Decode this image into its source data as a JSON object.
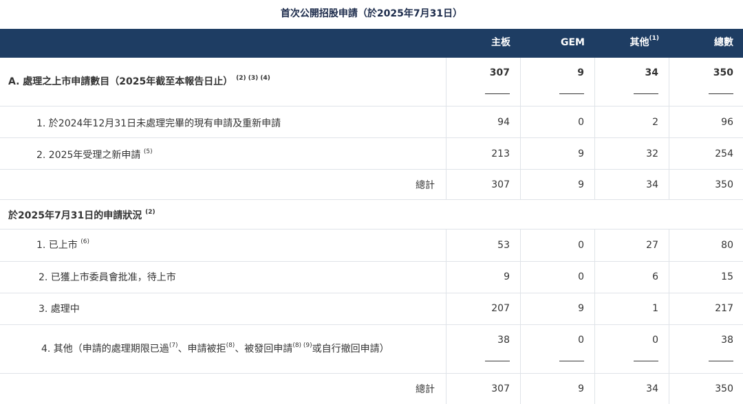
{
  "title": "首次公開招股申請（於2025年7月31日）",
  "header": {
    "col_main": "主板",
    "col_gem": "GEM",
    "col_other": "其他",
    "col_other_note": "(1)",
    "col_total": "總數"
  },
  "section_a": {
    "label": "A. 處理之上市申請數目（2025年截至本報告日止）",
    "notes": "(2) (3) (4)",
    "values": [
      "307",
      "9",
      "34",
      "350"
    ]
  },
  "section_a_rows": [
    {
      "label": "1. 於2024年12月31日未處理完畢的現有申請及重新申請",
      "notes": "",
      "values": [
        "94",
        "0",
        "2",
        "96"
      ]
    },
    {
      "label": "2. 2025年受理之新申請",
      "notes": "(5)",
      "values": [
        "213",
        "9",
        "32",
        "254"
      ]
    }
  ],
  "section_a_total": {
    "label": "總計",
    "values": [
      "307",
      "9",
      "34",
      "350"
    ]
  },
  "section_b": {
    "label": "於2025年7月31日的申請狀況",
    "notes": "(2)"
  },
  "section_b_rows": [
    {
      "label": "1. 已上市",
      "notes": "(6)",
      "values": [
        "53",
        "0",
        "27",
        "80"
      ]
    },
    {
      "label": "2. 已獲上市委員會批准，待上市",
      "notes": "",
      "values": [
        "9",
        "0",
        "6",
        "15"
      ]
    },
    {
      "label": "3. 處理中",
      "notes": "",
      "values": [
        "207",
        "9",
        "1",
        "217"
      ]
    },
    {
      "label_parts": {
        "a": "4. 其他（申請的處理期限已過",
        "n1": "(7)",
        "b": "、申請被拒",
        "n2": "(8)",
        "c": "、被發回申請",
        "n3": "(8) (9)",
        "d": "或自行撤回申請）"
      },
      "values": [
        "38",
        "0",
        "0",
        "38"
      ]
    }
  ],
  "section_b_total": {
    "label": "總計",
    "values": [
      "307",
      "9",
      "34",
      "350"
    ]
  }
}
